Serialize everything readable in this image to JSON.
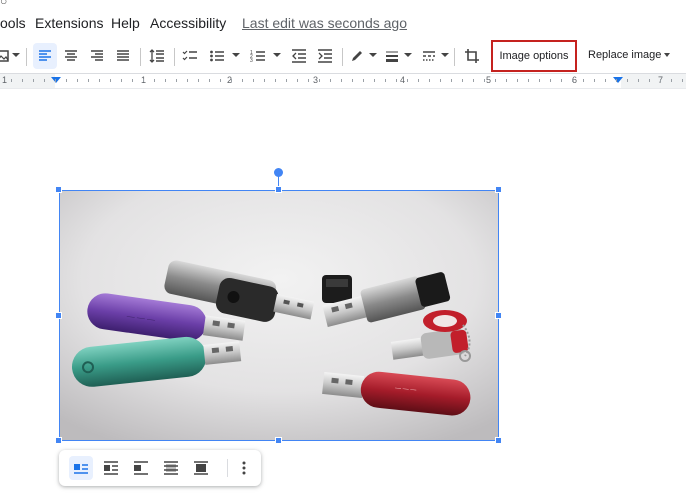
{
  "menu": {
    "partial_item": "ools",
    "extensions": "Extensions",
    "help": "Help",
    "accessibility": "Accessibility",
    "last_edit": "Last edit was seconds ago"
  },
  "toolbar": {
    "image_options_label": "Image options",
    "replace_image_label": "Replace image",
    "icons": [
      "insert-image-icon",
      "align-left-icon",
      "align-center-icon",
      "align-right-icon",
      "justify-icon",
      "line-spacing-icon",
      "checklist-icon",
      "bulleted-list-icon",
      "numbered-list-icon",
      "decrease-indent-icon",
      "increase-indent-icon",
      "pen-icon",
      "border-weight-icon",
      "border-dash-icon",
      "crop-icon"
    ]
  },
  "ruler": {
    "numbers": [
      "1",
      "1",
      "2",
      "3",
      "4",
      "5",
      "6",
      "7"
    ]
  },
  "image_toolbar": {
    "icons": [
      "wrap-inline-icon",
      "wrap-text-icon",
      "break-text-icon",
      "behind-text-icon",
      "in-front-of-text-icon",
      "more-options-icon"
    ]
  },
  "colors": {
    "accent": "#4285f4",
    "highlight_border": "#c5221f",
    "active_bg": "#e8f0fe"
  }
}
